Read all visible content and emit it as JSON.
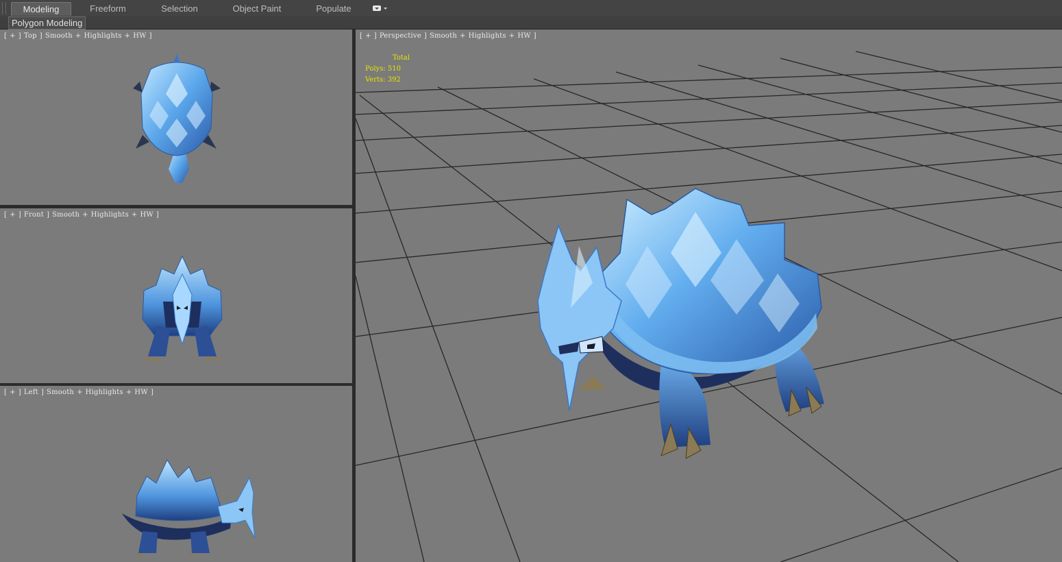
{
  "ribbon": {
    "tabs": [
      "Modeling",
      "Freeform",
      "Selection",
      "Object Paint",
      "Populate"
    ],
    "active_tab": "Modeling"
  },
  "subbar": {
    "label": "Polygon Modeling"
  },
  "viewports": {
    "top": {
      "parts": [
        "[",
        "+",
        "]",
        "Top",
        "]",
        "Smooth",
        "+",
        "Highlights",
        "+",
        "HW",
        "]"
      ]
    },
    "front": {
      "parts": [
        "[",
        "+",
        "]",
        "Front",
        "]",
        "Smooth",
        "+",
        "Highlights",
        "+",
        "HW",
        "]"
      ]
    },
    "left": {
      "parts": [
        "[",
        "+",
        "]",
        "Left",
        "]",
        "Smooth",
        "+",
        "Highlights",
        "+",
        "HW",
        "]"
      ]
    },
    "perspective": {
      "parts": [
        "[",
        "+",
        "]",
        "Perspective",
        "]",
        "Smooth",
        "+",
        "Highlights",
        "+",
        "HW",
        "]"
      ]
    }
  },
  "stats": {
    "total_label": "Total",
    "polys": "Polys: 510",
    "verts": "Verts: 392"
  },
  "colors": {
    "viewport_bg": "#7b7b7b",
    "grid_line": "#262626",
    "stats_text": "#e6e600",
    "crystal_light": "#a8d8ff",
    "crystal_mid": "#5aa6ea",
    "crystal_dark": "#244f9a",
    "claw": "#8a7a55"
  }
}
